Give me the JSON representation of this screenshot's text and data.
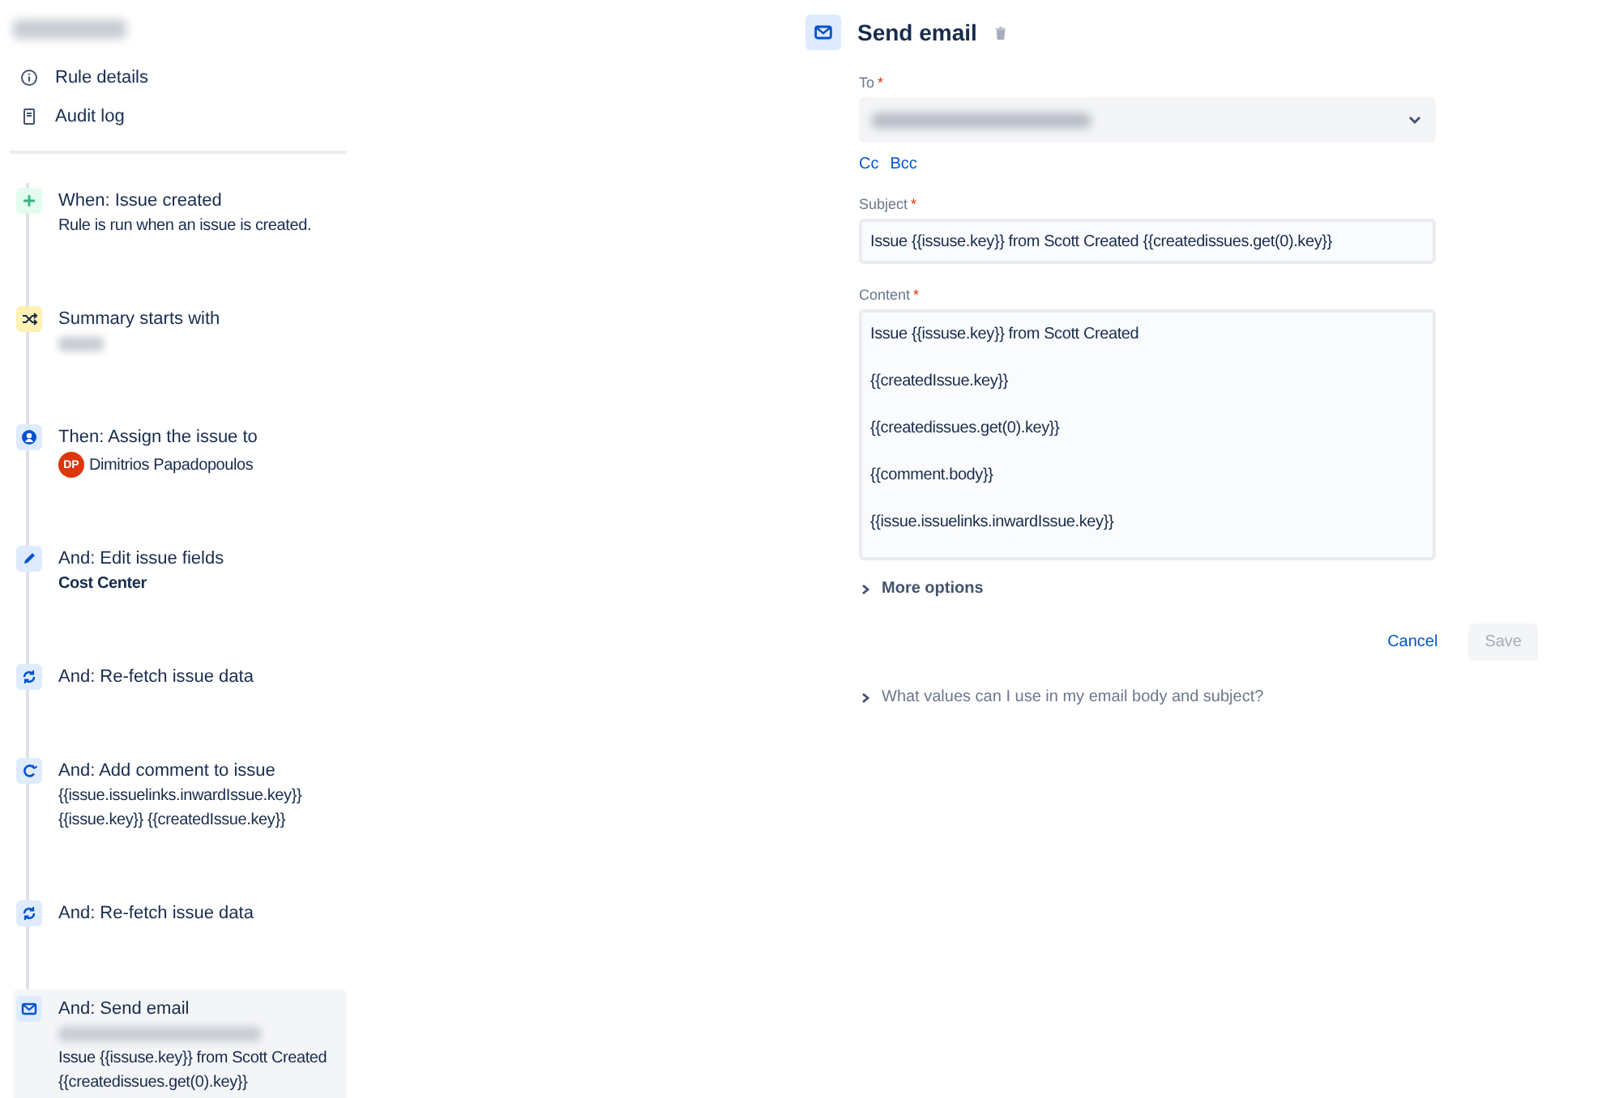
{
  "sidebar": {
    "links": [
      {
        "kind": "details",
        "label": "Rule details"
      },
      {
        "kind": "log",
        "label": "Audit log"
      }
    ],
    "steps": [
      {
        "kind": "trigger",
        "title": "When: Issue created",
        "selected": false,
        "details": [
          {
            "kind": "text",
            "text": "Rule is run when an issue is created."
          }
        ]
      },
      {
        "kind": "condition",
        "title": "Summary starts with",
        "selected": false,
        "details": [
          {
            "kind": "redacted"
          }
        ]
      },
      {
        "kind": "assign",
        "title": "Then: Assign the issue to",
        "selected": false,
        "details": [
          {
            "kind": "user",
            "initials": "DP",
            "name": "Dimitrios Papadopoulos",
            "color": "#de350b"
          }
        ]
      },
      {
        "kind": "edit",
        "title": "And: Edit issue fields",
        "selected": false,
        "details": [
          {
            "kind": "bold",
            "text": "Cost Center"
          }
        ]
      },
      {
        "kind": "refetch",
        "title": "And: Re-fetch issue data",
        "selected": false
      },
      {
        "kind": "comment",
        "title": "And: Add comment to issue",
        "selected": false,
        "details": [
          {
            "kind": "text",
            "text": "{{issue.issuelinks.inwardIssue.key}}"
          },
          {
            "kind": "text",
            "text": "{{issue.key}} {{createdIssue.key}}"
          }
        ]
      },
      {
        "kind": "refetch",
        "title": "And: Re-fetch issue data",
        "selected": false
      },
      {
        "kind": "email",
        "title": "And: Send email",
        "selected": true,
        "details": [
          {
            "kind": "redacted"
          },
          {
            "kind": "text",
            "text": "Issue {{issuse.key}} from Scott Created"
          },
          {
            "kind": "text",
            "text": "{{createdissues.get(0).key}}"
          }
        ]
      }
    ]
  },
  "panel": {
    "title": "Send email",
    "to": {
      "label": "To",
      "required_mark": "*"
    },
    "copy_links": [
      "Cc",
      "Bcc"
    ],
    "subject": {
      "label": "Subject",
      "required_mark": "*",
      "value": "Issue {{issuse.key}} from Scott Created {{createdissues.get(0).key}}"
    },
    "content": {
      "label": "Content",
      "required_mark": "*",
      "lines": [
        "Issue {{issuse.key}} from Scott Created",
        "{{createdIssue.key}}",
        "{{createdissues.get(0).key}}",
        "{{comment.body}}",
        "{{issue.issuelinks.inwardIssue.key}}"
      ]
    },
    "more_options": {
      "label": "More options",
      "expanded": false
    },
    "buttons": [
      {
        "kind": "cancel",
        "label": "Cancel",
        "disabled": false
      },
      {
        "kind": "save",
        "label": "Save",
        "disabled": true
      }
    ],
    "help": {
      "label": "What values can I use in my email body and subject?",
      "expanded": false
    }
  }
}
